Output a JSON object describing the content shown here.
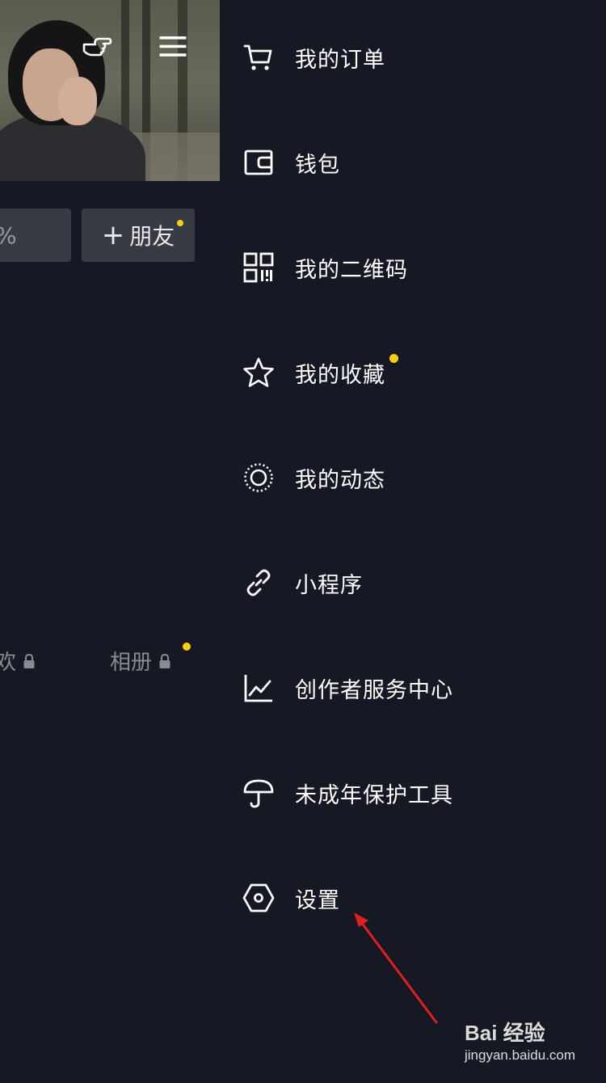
{
  "profile_background": {
    "add_friend_label": "朋友",
    "add_friend_plus": "+",
    "partial_button_text": "%",
    "tabs": [
      {
        "label": "欢"
      },
      {
        "label": "相册"
      }
    ]
  },
  "drawer": {
    "items": [
      {
        "label": "我的订单",
        "icon": "cart-icon"
      },
      {
        "label": "钱包",
        "icon": "wallet-icon"
      },
      {
        "label": "我的二维码",
        "icon": "qr-code-icon"
      },
      {
        "label": "我的收藏",
        "icon": "star-icon",
        "has_badge": true
      },
      {
        "label": "我的动态",
        "icon": "moments-icon"
      },
      {
        "label": "小程序",
        "icon": "link-icon"
      },
      {
        "label": "创作者服务中心",
        "icon": "chart-icon"
      },
      {
        "label": "未成年保护工具",
        "icon": "umbrella-icon"
      },
      {
        "label": "设置",
        "icon": "hexagon-settings-icon"
      }
    ]
  },
  "watermark": {
    "brand": "Bai 经验",
    "url": "jingyan.baidu.com"
  },
  "colors": {
    "background": "#161823",
    "button": "#393b44",
    "badge": "#face15",
    "annotation_arrow": "#e02020"
  }
}
